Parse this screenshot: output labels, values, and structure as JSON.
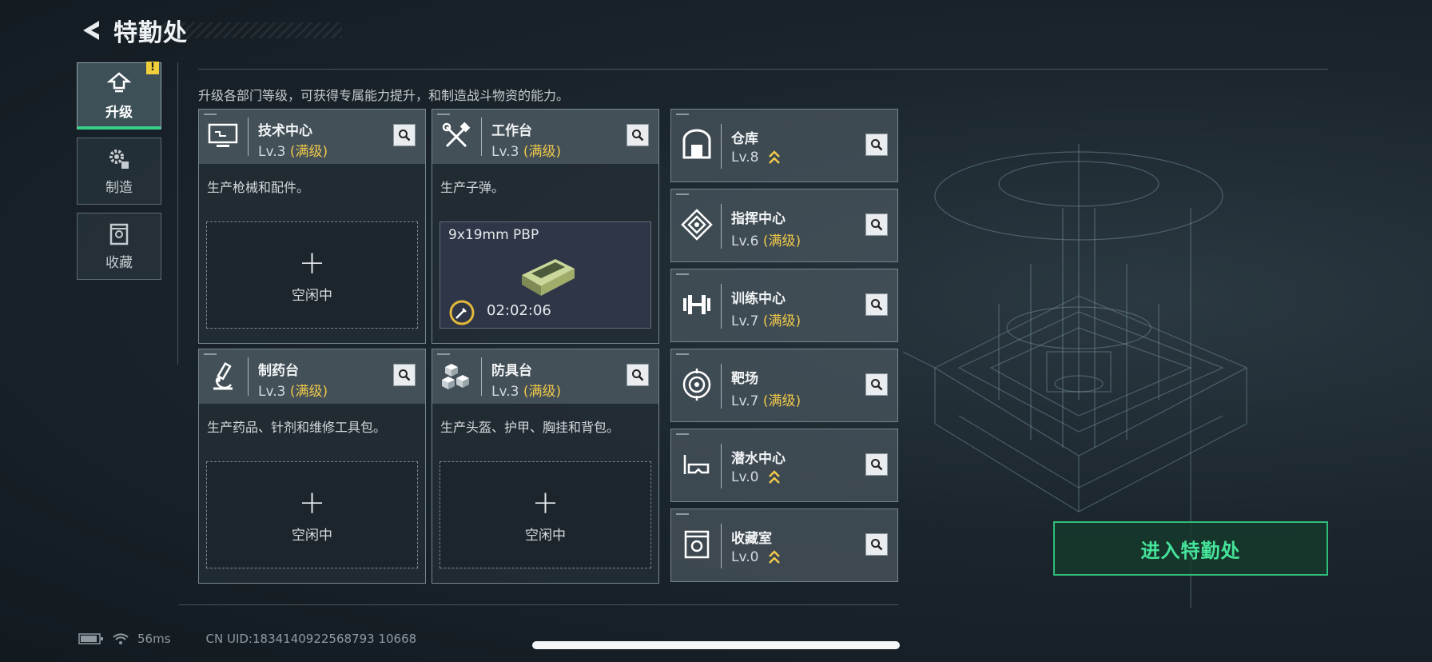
{
  "header": {
    "title": "特勤处"
  },
  "sidebar": {
    "tabs": [
      {
        "label": "升级",
        "active": true,
        "badge": "!"
      },
      {
        "label": "制造",
        "active": false
      },
      {
        "label": "收藏",
        "active": false
      }
    ]
  },
  "main": {
    "subtitle": "升级各部门等级，可获得专属能力提升，和制造战斗物资的能力。",
    "workshops": [
      {
        "name": "技术中心",
        "level": "Lv.3",
        "status": "(满级)",
        "desc": "生产枪械和配件。",
        "slot": {
          "state": "idle",
          "text": "空闲中",
          "plus": "+"
        }
      },
      {
        "name": "工作台",
        "level": "Lv.3",
        "status": "(满级)",
        "desc": "生产子弹。",
        "slot": {
          "state": "producing",
          "item": "9x19mm PBP",
          "time": "02:02:06"
        }
      },
      {
        "name": "制药台",
        "level": "Lv.3",
        "status": "(满级)",
        "desc": "生产药品、针剂和维修工具包。",
        "slot": {
          "state": "idle",
          "text": "空闲中",
          "plus": "+"
        }
      },
      {
        "name": "防具台",
        "level": "Lv.3",
        "status": "(满级)",
        "desc": "生产头盔、护甲、胸挂和背包。",
        "slot": {
          "state": "idle",
          "text": "空闲中",
          "plus": "+"
        }
      }
    ],
    "facilities": [
      {
        "name": "仓库",
        "level": "Lv.8",
        "status": "",
        "upgradable": true,
        "icon": "warehouse-icon"
      },
      {
        "name": "指挥中心",
        "level": "Lv.6",
        "status": "(满级)",
        "upgradable": false,
        "icon": "command-icon"
      },
      {
        "name": "训练中心",
        "level": "Lv.7",
        "status": "(满级)",
        "upgradable": false,
        "icon": "dumbbell-icon"
      },
      {
        "name": "靶场",
        "level": "Lv.7",
        "status": "(满级)",
        "upgradable": false,
        "icon": "target-icon"
      },
      {
        "name": "潜水中心",
        "level": "Lv.0",
        "status": "",
        "upgradable": true,
        "icon": "dive-mask-icon"
      },
      {
        "name": "收藏室",
        "level": "Lv.0",
        "status": "",
        "upgradable": true,
        "icon": "vault-icon"
      }
    ]
  },
  "enter_button": {
    "label": "进入特勤处"
  },
  "status_bar": {
    "ping": "56ms",
    "uid": "CN UID:1834140922568793 10668"
  },
  "colors": {
    "accent_green": "#39d08a",
    "maxed_gold": "#f0c84a",
    "upgrade_chevron": "#f2c94c"
  }
}
